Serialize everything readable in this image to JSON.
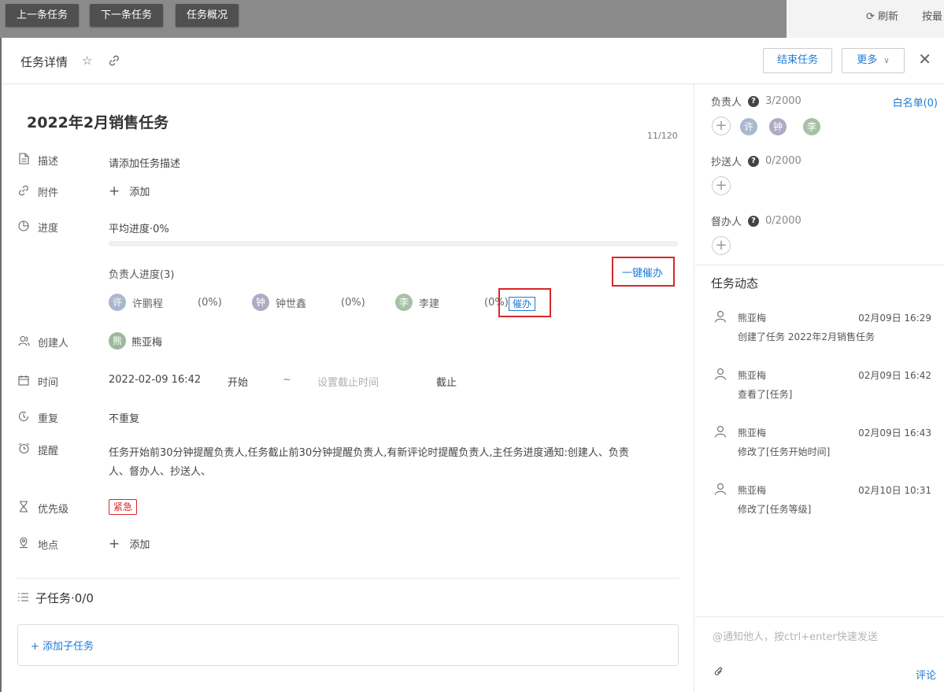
{
  "nav": {
    "prev": "上一条任务",
    "next": "下一条任务",
    "overview": "任务概况",
    "refresh": "刷新",
    "sort": "按最"
  },
  "header": {
    "title": "任务详情",
    "end_task": "结束任务",
    "more": "更多"
  },
  "task": {
    "title": "2022年2月销售任务",
    "char_count": "11/120",
    "description_label": "描述",
    "description_value": "请添加任务描述",
    "attachment_label": "附件",
    "attachment_add": "添加",
    "progress_label": "进度",
    "progress_value": "平均进度·0%",
    "progress_percent": 0,
    "assignee_progress_title": "负责人进度(3)",
    "remind_all": "一键催办",
    "assignees": [
      {
        "initial": "许",
        "name": "许鹏程",
        "pct": "(0%)",
        "color": "#a9b8cf"
      },
      {
        "initial": "钟",
        "name": "钟世鑫",
        "pct": "(0%)",
        "color": "#b0a9c3"
      },
      {
        "initial": "李",
        "name": "李建",
        "pct": "(0%)",
        "color": "#a8c0a6"
      }
    ],
    "remind_single": "催办",
    "creator_label": "创建人",
    "creator_initial": "熊",
    "creator_name": "熊亚梅",
    "creator_color": "#9db79a",
    "time_label": "时间",
    "start_time": "2022-02-09 16:42",
    "start_word": "开始",
    "tilde": "~",
    "deadline_placeholder": "设置截止时间",
    "deadline_word": "截止",
    "repeat_label": "重复",
    "repeat_value": "不重复",
    "remind_label": "提醒",
    "remind_line1": "任务开始前30分钟提醒负责人,任务截止前30分钟提醒负责人,有新评论时提醒负责人,主任务进度通知:创建人、负责",
    "remind_line2": "人、督办人、抄送人、",
    "priority_label": "优先级",
    "priority_value": "紧急",
    "location_label": "地点",
    "location_add": "添加",
    "subtask_title": "子任务·0/0",
    "subtask_add": "+ 添加子任务"
  },
  "side": {
    "owner_label": "负责人",
    "owner_count": "3/2000",
    "whitelist": "白名单(0)",
    "owner_avatars": [
      {
        "initial": "许",
        "color": "#a9b8cf"
      },
      {
        "initial": "钟",
        "color": "#b0a9c3"
      },
      {
        "initial": "李",
        "color": "#a8c0a6"
      }
    ],
    "cc_label": "抄送人",
    "cc_count": "0/2000",
    "supervisor_label": "督办人",
    "supervisor_count": "0/2000",
    "activity_title": "任务动态",
    "events": [
      {
        "who": "熊亚梅",
        "when": "02月09日 16:29",
        "what": "创建了任务 2022年2月销售任务"
      },
      {
        "who": "熊亚梅",
        "when": "02月09日 16:42",
        "what": "查看了[任务]"
      },
      {
        "who": "熊亚梅",
        "when": "02月09日 16:43",
        "what": "修改了[任务开始时间]"
      },
      {
        "who": "熊亚梅",
        "when": "02月10日 10:31",
        "what": "修改了[任务等级]"
      }
    ],
    "comment_placeholder": "@通知他人，按ctrl+enter快速发送",
    "comment_button": "评论"
  },
  "colors": {
    "accent": "#1c7ad5",
    "urgent": "#d6282a",
    "highlight_box": "#d6282a"
  }
}
